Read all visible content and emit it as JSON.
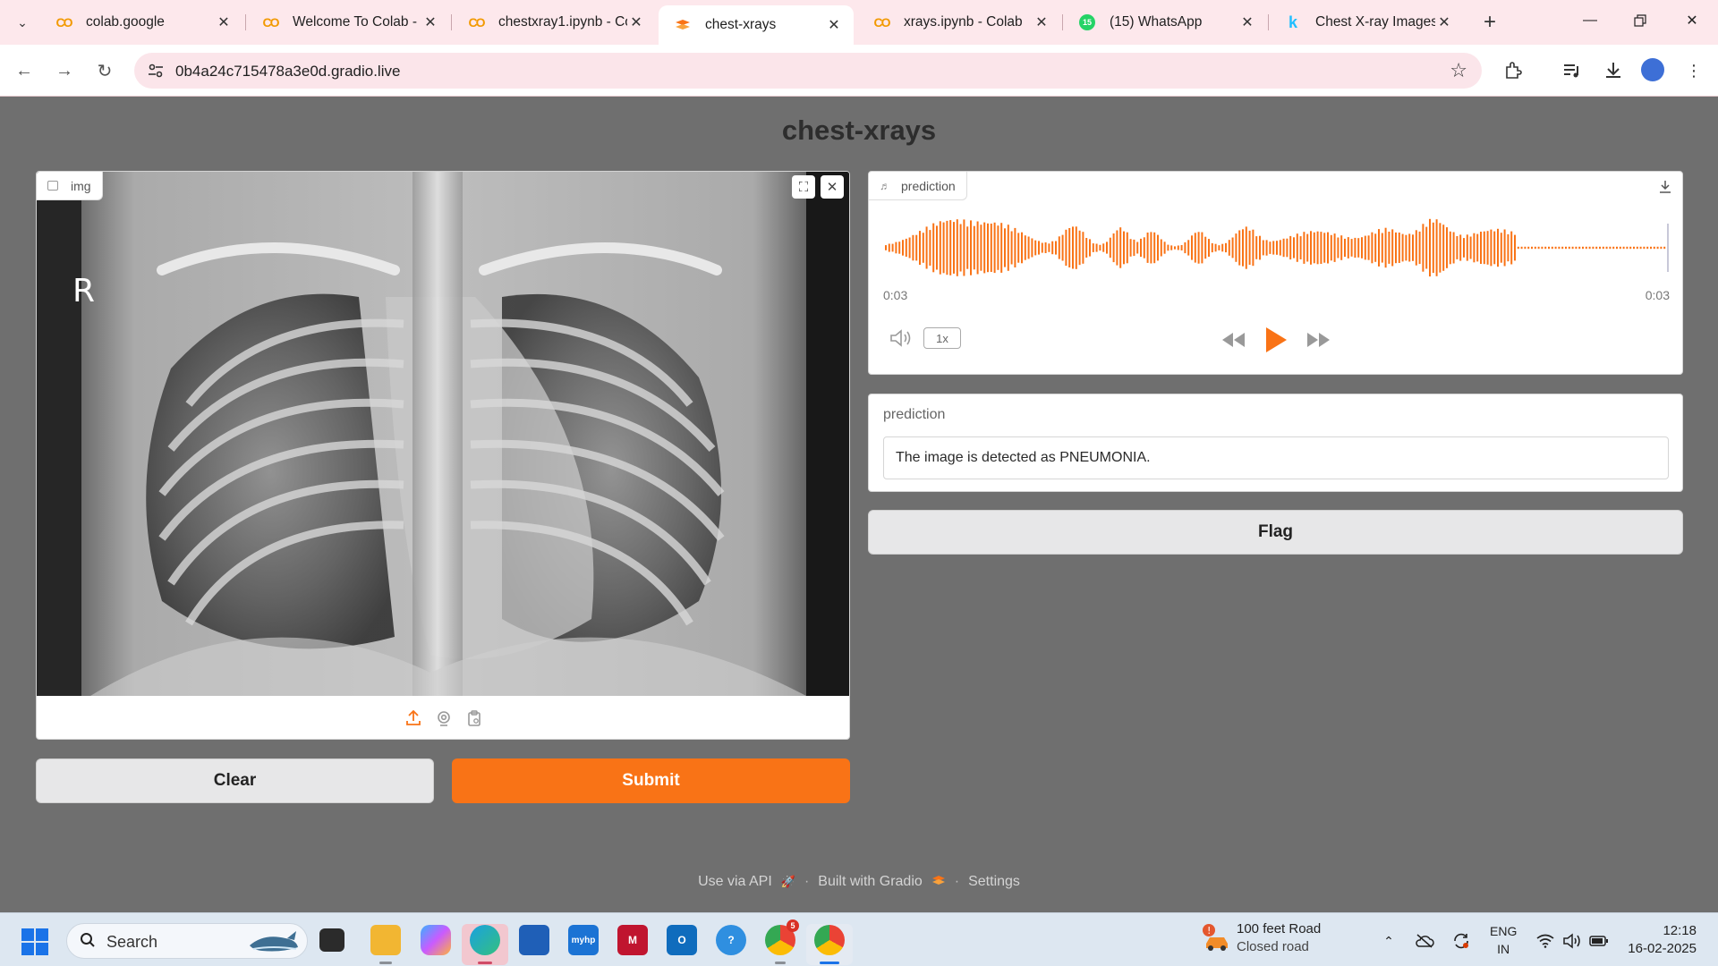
{
  "browser": {
    "tabs": [
      {
        "label": "colab.google",
        "favicon": "colab-icon"
      },
      {
        "label": "Welcome To Colab -",
        "favicon": "colab-icon"
      },
      {
        "label": "chestxray1.ipynb - Co",
        "favicon": "colab-icon"
      },
      {
        "label": "chest-xrays",
        "favicon": "gradio-icon",
        "active": true
      },
      {
        "label": "xrays.ipynb - Colab",
        "favicon": "colab-icon"
      },
      {
        "label": "(15) WhatsApp",
        "favicon": "whatsapp-icon",
        "badge": "15"
      },
      {
        "label": "Chest X-ray Images",
        "favicon": "kaggle-icon"
      }
    ],
    "url": "0b4a24c715478a3e0d.gradio.live"
  },
  "app": {
    "title": "chest-xrays",
    "image_input": {
      "label": "img",
      "marker_letter": "R"
    },
    "clear_label": "Clear",
    "submit_label": "Submit",
    "audio_output": {
      "label": "prediction",
      "current_time": "0:03",
      "duration": "0:03",
      "speed": "1x",
      "accent": "#f97316"
    },
    "text_output": {
      "label": "prediction",
      "value": "The image is detected as PNEUMONIA."
    },
    "flag_label": "Flag",
    "footer": {
      "api": "Use via API",
      "built": "Built with Gradio",
      "settings": "Settings",
      "separator": "·"
    }
  },
  "taskbar": {
    "search_placeholder": "Search",
    "weather": {
      "line1": "100 feet Road",
      "line2": "Closed road"
    },
    "language": {
      "line1": "ENG",
      "line2": "IN"
    },
    "clock": {
      "time": "12:18",
      "date": "16-02-2025"
    },
    "chrome_badge": "5"
  }
}
